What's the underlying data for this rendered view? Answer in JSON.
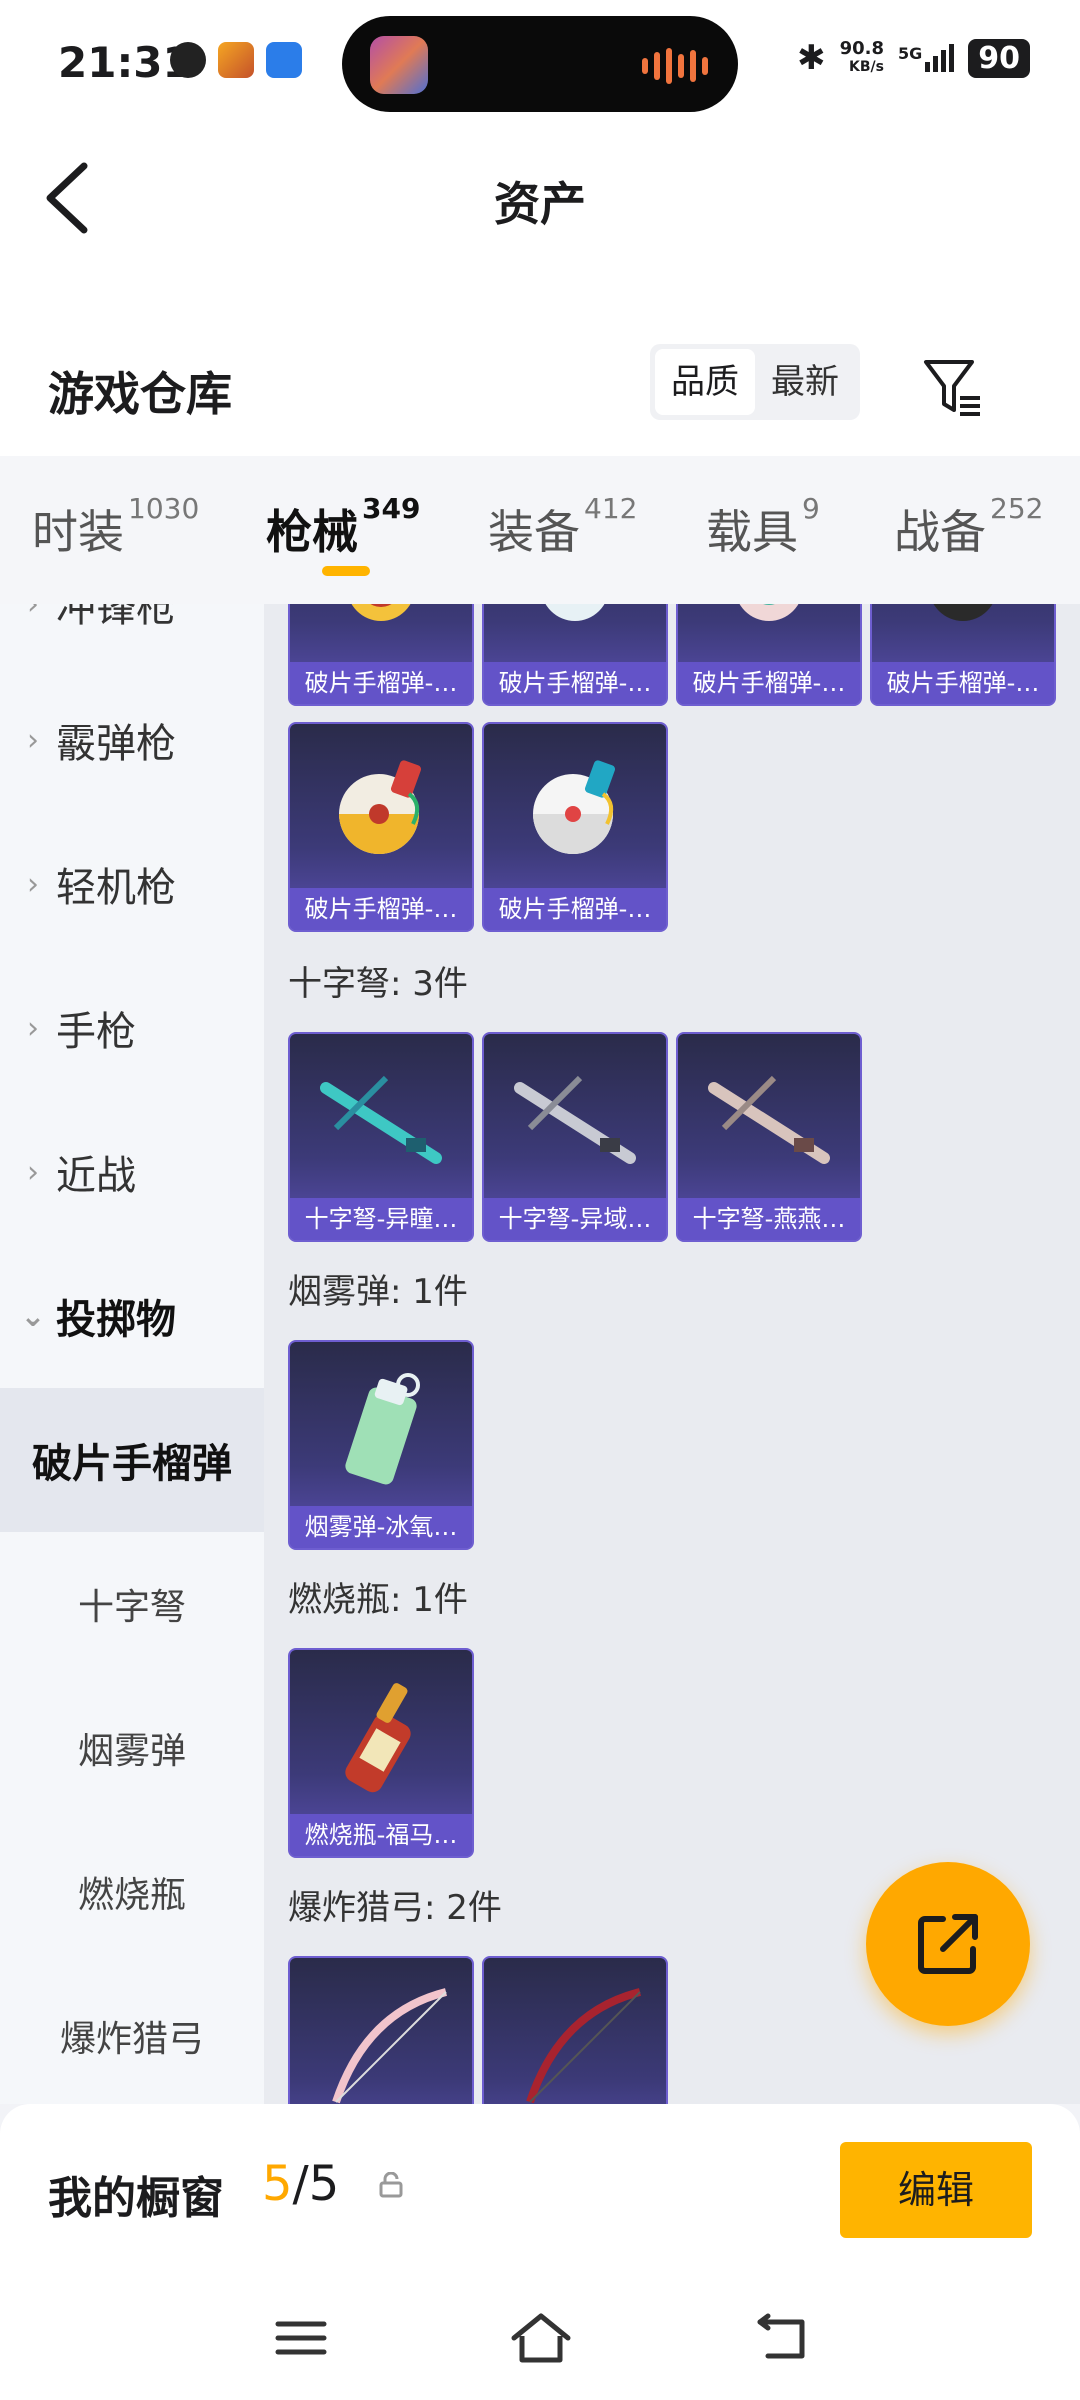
{
  "status_bar": {
    "time": "21:31",
    "speed_value": "90.8",
    "speed_unit": "KB/s",
    "network": "5G",
    "battery": "90"
  },
  "header": {
    "title": "资产"
  },
  "warehouse": {
    "title": "游戏仓库",
    "sort_options": [
      "品质",
      "最新"
    ],
    "active_sort": "品质"
  },
  "tabs": [
    {
      "label": "时装",
      "count": "1030"
    },
    {
      "label": "枪械",
      "count": "349"
    },
    {
      "label": "装备",
      "count": "412"
    },
    {
      "label": "载具",
      "count": "9"
    },
    {
      "label": "战备",
      "count": "252"
    }
  ],
  "categories": {
    "cut_top": "冲锋枪",
    "shotgun": "霰弹枪",
    "lmg": "轻机枪",
    "pistol": "手枪",
    "melee": "近战",
    "throwables": "投掷物",
    "selected": "破片手榴弹",
    "crossbow": "十字弩",
    "smoke": "烟雾弹",
    "molotov": "燃烧瓶",
    "bow": "爆炸猎弓"
  },
  "sections": {
    "grenade": {
      "row1": [
        "破片手榴弹-…",
        "破片手榴弹-…",
        "破片手榴弹-…",
        "破片手榴弹-…"
      ],
      "row2": [
        "破片手榴弹-…",
        "破片手榴弹-…"
      ]
    },
    "crossbow": {
      "title": "十字弩: 3件",
      "items": [
        "十字弩-异瞳…",
        "十字弩-异域…",
        "十字弩-燕燕…"
      ]
    },
    "smoke": {
      "title": "烟雾弹: 1件",
      "items": [
        "烟雾弹-冰氧…"
      ]
    },
    "molotov": {
      "title": "燃烧瓶: 1件",
      "items": [
        "燃烧瓶-福马…"
      ]
    },
    "bow": {
      "title": "爆炸猎弓: 2件"
    }
  },
  "showcase": {
    "title": "我的橱窗",
    "current": "5",
    "separator_total": "/5",
    "edit_label": "编辑"
  },
  "colors": {
    "accent": "#ffb400",
    "card_label": "#6353c8",
    "card_bg": "#3c3a78"
  }
}
